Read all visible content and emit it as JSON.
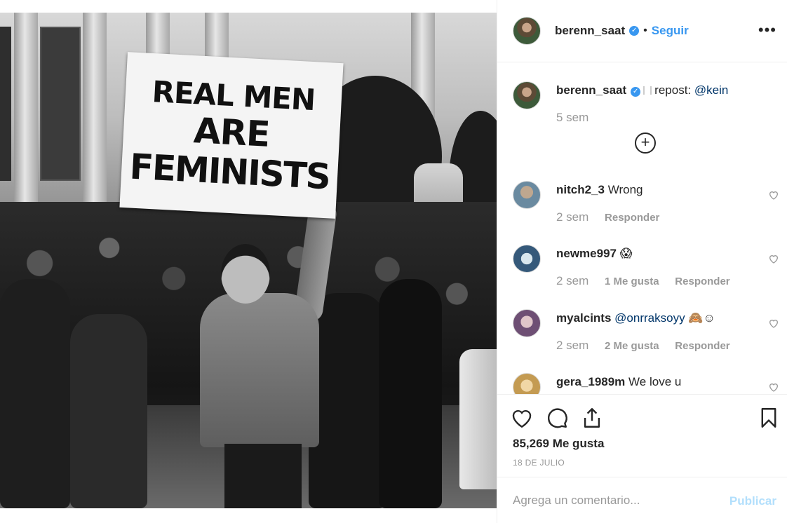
{
  "post": {
    "sign_line1": "REAL MEN",
    "sign_line2": "ARE",
    "sign_line3": "FEMINISTS"
  },
  "header": {
    "username": "berenn_saat",
    "verified_icon": "verified-badge-icon",
    "separator": "•",
    "follow_label": "Seguir",
    "more_icon": "more-options-icon",
    "more_glyph": "•••"
  },
  "caption": {
    "username": "berenn_saat",
    "text": "repost:",
    "mention": "@kein",
    "time": "5 sem"
  },
  "load_more_icon": "plus-circle-icon",
  "comments": [
    {
      "username": "nitch2_3",
      "text": "Wrong",
      "time": "2 sem",
      "likes": "",
      "reply": "Responder"
    },
    {
      "username": "newme997",
      "text": "😱",
      "time": "2 sem",
      "likes": "1 Me gusta",
      "reply": "Responder"
    },
    {
      "username": "myalcints",
      "text": "🙈☺",
      "mention": "@onrraksoyy",
      "time": "2 sem",
      "likes": "2 Me gusta",
      "reply": "Responder"
    },
    {
      "username": "gera_1989m",
      "text": "We love u",
      "time": "",
      "likes": "",
      "reply": ""
    }
  ],
  "actions": {
    "like_icon": "heart-icon",
    "comment_icon": "comment-icon",
    "share_icon": "share-icon",
    "save_icon": "bookmark-icon",
    "likes_count": "85,269 Me gusta",
    "date": "18 DE JULIO"
  },
  "composer": {
    "placeholder": "Agrega un comentario...",
    "post_label": "Publicar"
  },
  "colors": {
    "link": "#3897f0",
    "muted": "#999999",
    "post_disabled": "#b2dffc"
  }
}
